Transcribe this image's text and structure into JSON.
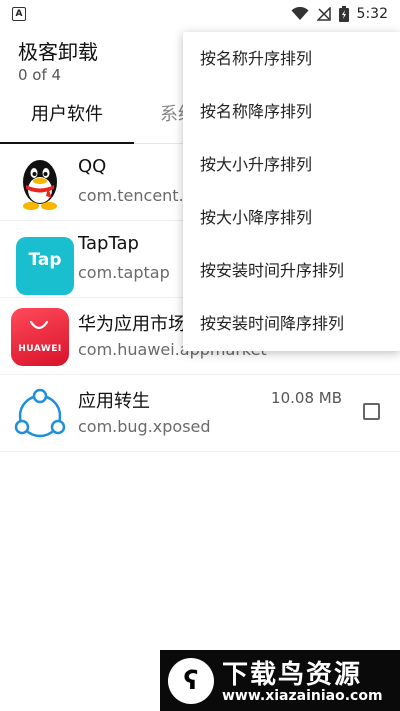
{
  "status_bar": {
    "time": "5:32",
    "icons": [
      "notification-a-icon",
      "wifi-icon",
      "no-signal-icon",
      "battery-icon"
    ]
  },
  "app_bar": {
    "title": "极客卸载",
    "subtitle": "0 of 4"
  },
  "tabs": [
    {
      "label": "用户软件",
      "selected": true
    },
    {
      "label": "系统",
      "selected": false
    }
  ],
  "apps": [
    {
      "name": "QQ",
      "package": "com.tencent.",
      "icon": "qq-penguin-icon"
    },
    {
      "name": "TapTap",
      "package": "com.taptap",
      "icon": "taptap-icon",
      "icon_text": "Tap"
    },
    {
      "name": "华为应用市场",
      "package": "com.huawei.appmarket",
      "icon": "huawei-icon",
      "icon_text": "HUAWEI"
    },
    {
      "name": "应用转生",
      "package": "com.bug.xposed",
      "size": "10.08 MB",
      "icon": "share-circle-icon",
      "checked": false
    }
  ],
  "sort_menu": [
    "按名称升序排列",
    "按名称降序排列",
    "按大小升序排列",
    "按大小降序排列",
    "按安装时间升序排列",
    "按安装时间降序排列"
  ],
  "watermark": {
    "title": "下载鸟资源",
    "url": "www.xiazainiao.com"
  },
  "colors": {
    "taptap": "#19bfcf",
    "huawei": "#e8192c",
    "share_icon": "#1e8fd8"
  }
}
